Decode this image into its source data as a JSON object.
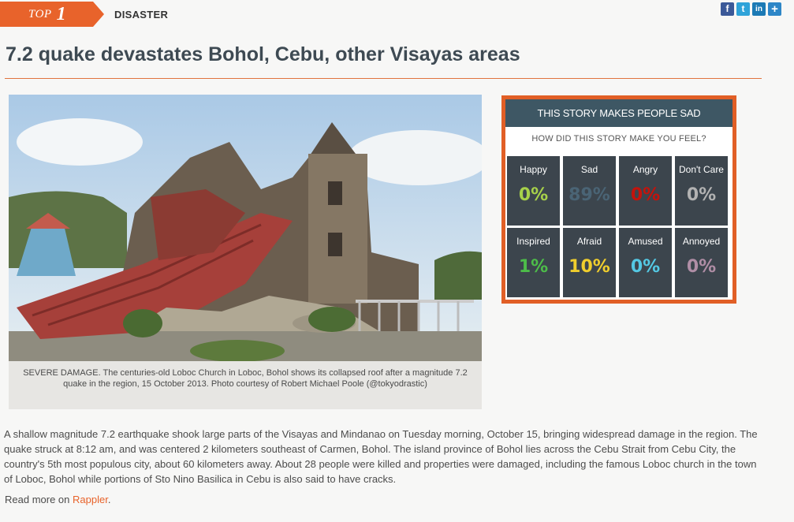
{
  "header": {
    "rank_word": "TOP",
    "rank_number": "1",
    "category": "DISASTER",
    "share_icons": [
      "facebook-icon",
      "twitter-icon",
      "linkedin-icon",
      "plus-icon"
    ]
  },
  "article": {
    "title": "7.2 quake devastates Bohol, Cebu, other Visayas areas",
    "photo_caption": "SEVERE DAMAGE. The centuries-old Loboc Church in Loboc, Bohol shows its collapsed roof after a magnitude 7.2 quake in the region, 15 October 2013. Photo courtesy of Robert Michael Poole (@tokyodrastic)",
    "body": "A shallow magnitude 7.2 earthquake shook large parts of the Visayas and Mindanao on Tuesday morning, October 15, bringing widespread damage in the region. The quake struck at 8:12 am, and was centered 2 kilometers southeast of Carmen, Bohol. The island province of Bohol lies across the Cebu Strait from Cebu City, the country's 5th most populous city, about 60 kilometers away. About 28 people were killed and properties were damaged, including the famous Loboc church in the town of Loboc, Bohol while portions of Sto Nino Basilica in Cebu is also said to have cracks.",
    "read_more_prefix": "Read more on ",
    "read_more_link": "Rappler",
    "read_more_suffix": "."
  },
  "mood_widget": {
    "heading": "THIS STORY MAKES PEOPLE SAD",
    "question": "HOW DID THIS STORY MAKE YOU FEEL?",
    "accent_color": "#e15f26",
    "moods": [
      {
        "label": "Happy",
        "percent": "0%",
        "color": "#a7d14a"
      },
      {
        "label": "Sad",
        "percent": "89%",
        "color": "#4a6475"
      },
      {
        "label": "Angry",
        "percent": "0%",
        "color": "#c4130c"
      },
      {
        "label": "Don't Care",
        "percent": "0%",
        "color": "#b2b2b2"
      },
      {
        "label": "Inspired",
        "percent": "1%",
        "color": "#4dbd49"
      },
      {
        "label": "Afraid",
        "percent": "10%",
        "color": "#f0ce2d"
      },
      {
        "label": "Amused",
        "percent": "0%",
        "color": "#54c9e4"
      },
      {
        "label": "Annoyed",
        "percent": "0%",
        "color": "#b08ea6"
      }
    ]
  }
}
